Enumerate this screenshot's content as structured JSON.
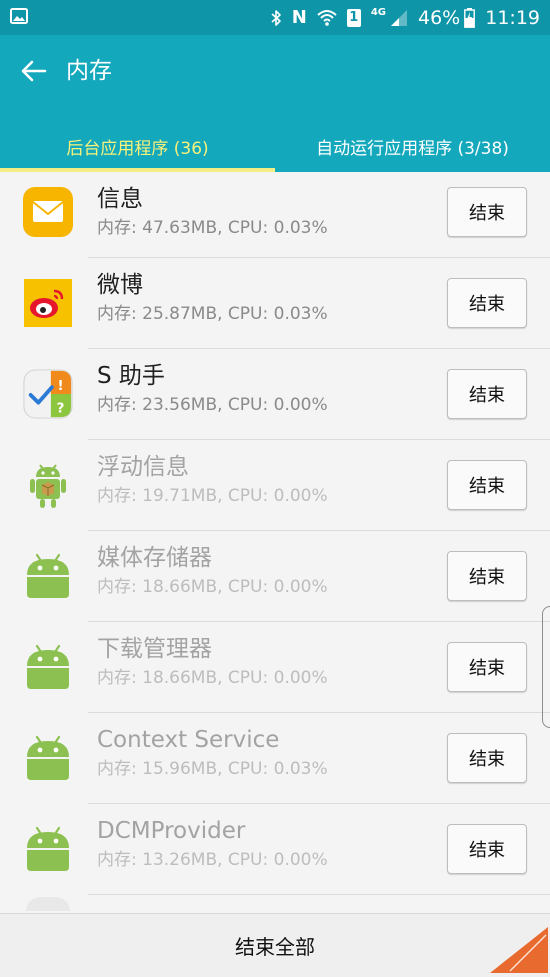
{
  "status_bar": {
    "battery_percent": "46%",
    "time": "11:19",
    "network_label": "4G",
    "sim_label": "1",
    "nfc_label": "N"
  },
  "app_bar": {
    "title": "内存"
  },
  "tabs": [
    {
      "label": "后台应用程序 (36)",
      "active": true
    },
    {
      "label": "自动运行应用程序 (3/38)",
      "active": false
    }
  ],
  "apps": [
    {
      "name": "信息",
      "stats": "内存: 47.63MB, CPU: 0.03%",
      "icon": "messages-icon",
      "dim": false,
      "end_label": "结束"
    },
    {
      "name": "微博",
      "stats": "内存: 25.87MB, CPU: 0.03%",
      "icon": "weibo-icon",
      "dim": false,
      "end_label": "结束"
    },
    {
      "name": "S 助手",
      "stats": "内存: 23.56MB, CPU: 0.00%",
      "icon": "s-assistant-icon",
      "dim": false,
      "end_label": "结束"
    },
    {
      "name": "浮动信息",
      "stats": "内存: 19.71MB, CPU: 0.00%",
      "icon": "android-package-icon",
      "dim": true,
      "end_label": "结束"
    },
    {
      "name": "媒体存储器",
      "stats": "内存: 18.66MB, CPU: 0.00%",
      "icon": "android-icon",
      "dim": true,
      "end_label": "结束"
    },
    {
      "name": "下载管理器",
      "stats": "内存: 18.66MB, CPU: 0.00%",
      "icon": "android-icon",
      "dim": true,
      "end_label": "结束"
    },
    {
      "name": "Context Service",
      "stats": "内存: 15.96MB, CPU: 0.03%",
      "icon": "android-icon",
      "dim": true,
      "end_label": "结束"
    },
    {
      "name": "DCMProvider",
      "stats": "内存: 13.26MB, CPU: 0.00%",
      "icon": "android-icon",
      "dim": true,
      "end_label": "结束"
    }
  ],
  "bottom_button": {
    "label": "结束全部"
  },
  "colors": {
    "status_bar": "#0f95a8",
    "app_bar": "#14a8bd",
    "active_tab": "#f8f27a",
    "indicator": "#f3ef86",
    "android_green": "#8cc152"
  }
}
